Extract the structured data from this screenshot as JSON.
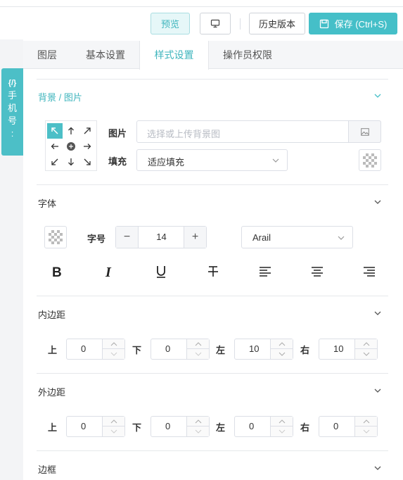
{
  "toolbar": {
    "preview_label": "预览",
    "history_label": "历史版本",
    "save_label": "保存 (Ctrl+S)"
  },
  "tabs": [
    "图层",
    "基本设置",
    "样式设置",
    "操作员权限"
  ],
  "active_tab": "样式设置",
  "side_tag": {
    "lines": [
      "{/}",
      "手",
      "机",
      "号",
      ":"
    ]
  },
  "background_section": {
    "title": "背景 / 图片",
    "image_label": "图片",
    "image_placeholder": "选择或上传背景图",
    "fill_label": "填充",
    "fill_value": "适应填充"
  },
  "font_section": {
    "title": "字体",
    "size_label": "字号",
    "size_value": "14",
    "font_family_value": "Arail",
    "decrement": "−",
    "increment": "+"
  },
  "padding_section": {
    "title": "内边距",
    "top_label": "上",
    "top_value": "0",
    "bottom_label": "下",
    "bottom_value": "0",
    "left_label": "左",
    "left_value": "10",
    "right_label": "右",
    "right_value": "10"
  },
  "margin_section": {
    "title": "外边距",
    "top_label": "上",
    "top_value": "0",
    "bottom_label": "下",
    "bottom_value": "0",
    "left_label": "左",
    "left_value": "0",
    "right_label": "右",
    "right_value": "0"
  },
  "border_section": {
    "title": "边框"
  },
  "colors": {
    "accent": "#45bfc8",
    "border": "#dcdfe6",
    "text": "#333333",
    "muted": "#b8bcc4"
  }
}
